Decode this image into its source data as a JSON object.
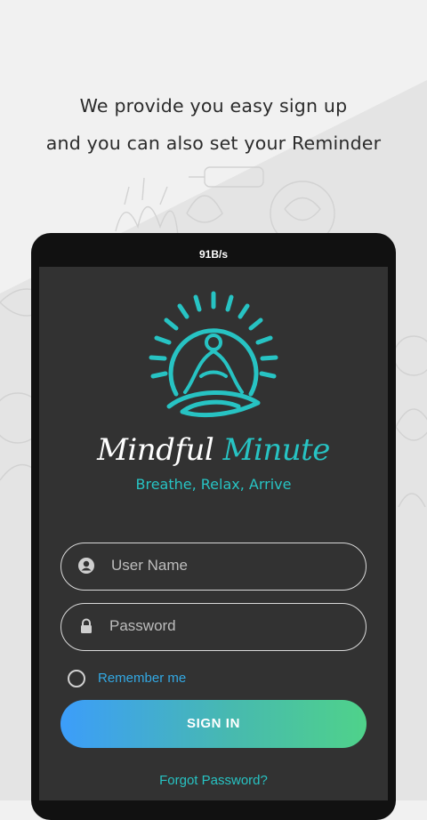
{
  "promo": {
    "line1": "We provide you easy sign up",
    "line2": "and you can also set your Reminder"
  },
  "status_bar": {
    "net_speed": "91B/s"
  },
  "app": {
    "title_part1": "Mindful",
    "title_part2": "Minute",
    "tagline": "Breathe, Relax, Arrive"
  },
  "form": {
    "username_placeholder": "User Name",
    "password_placeholder": "Password",
    "remember_label": "Remember me",
    "remember_checked": false,
    "signin_label": "SIGN IN",
    "forgot_label": "Forgot Password?"
  },
  "colors": {
    "accent": "#27c3c3",
    "link": "#32a8e3",
    "screen_bg": "#323232",
    "gradient_start": "#3c9dfa",
    "gradient_end": "#4fd28a"
  },
  "icons": [
    "meditation-logo-icon",
    "user-icon",
    "lock-icon"
  ]
}
